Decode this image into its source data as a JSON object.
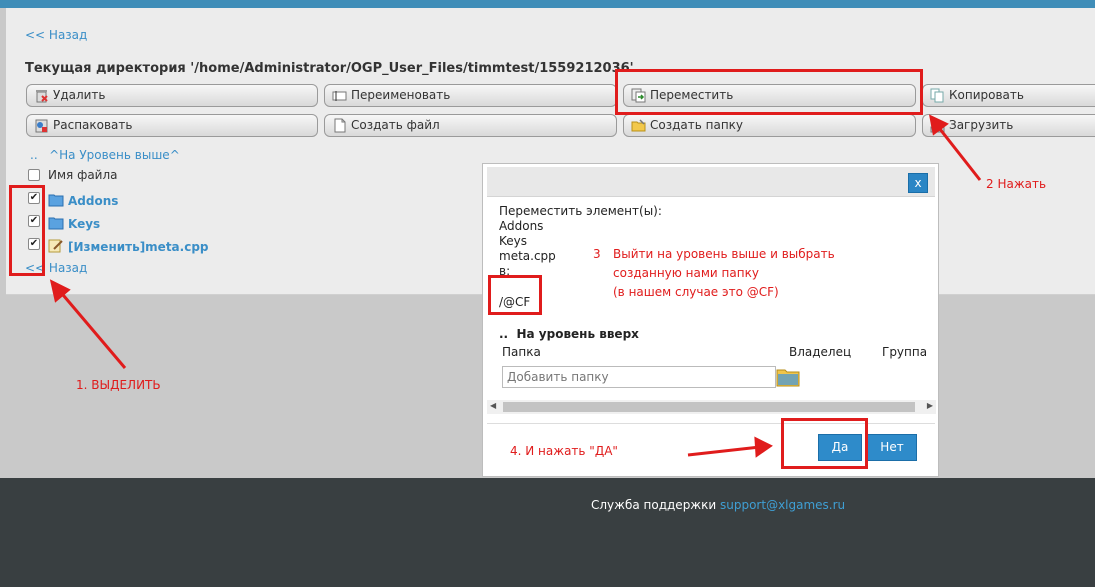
{
  "nav": {
    "back_top": "<< Назад",
    "back_bottom": "<< Назад"
  },
  "current_dir": "Текущая директория '/home/Administrator/OGP_User_Files/timmtest/1559212036'",
  "toolbar": {
    "delete": "Удалить",
    "rename": "Переименовать",
    "move": "Переместить",
    "copy": "Копировать",
    "unpack": "Распаковать",
    "create_file": "Создать файл",
    "create_folder": "Создать папку",
    "upload": "Загрузить"
  },
  "listing": {
    "up_link": "..   ^На Уровень выше^",
    "header": "Имя файла",
    "rows": [
      {
        "name": "Addons",
        "checked": true
      },
      {
        "name": "Keys",
        "checked": true
      },
      {
        "name": "[Изменить]meta.cpp",
        "checked": true
      }
    ]
  },
  "dialog": {
    "close": "x",
    "move_label": "Переместить элемент(ы):",
    "items": [
      "Addons",
      "Keys",
      "meta.cpp"
    ],
    "to_label": "в:",
    "destination": "/@CF",
    "up_level": "..  На уровень вверх",
    "col_folder": "Папка",
    "col_owner": "Владелец",
    "col_group": "Группа",
    "add_folder_placeholder": "Добавить папку",
    "yes": "Да",
    "no": "Нет"
  },
  "footer": {
    "label": "Служба поддержки",
    "email": "support@xlgames.ru"
  },
  "annotations": {
    "step1": "1. ВЫДЕЛИТЬ",
    "step2": "2 Нажать",
    "step3_num": "3",
    "step3_l1": "Выйти на уровень выше и выбрать",
    "step3_l2": "созданную нами папку",
    "step3_l3": "(в нашем случае это @CF)",
    "step4": "4. И нажать \"ДА\""
  },
  "colors": {
    "accent": "#3f8db8",
    "link": "#3a8ec7",
    "annotation": "#e01c1c",
    "button": "#2e8bca",
    "footer": "#393f41"
  }
}
